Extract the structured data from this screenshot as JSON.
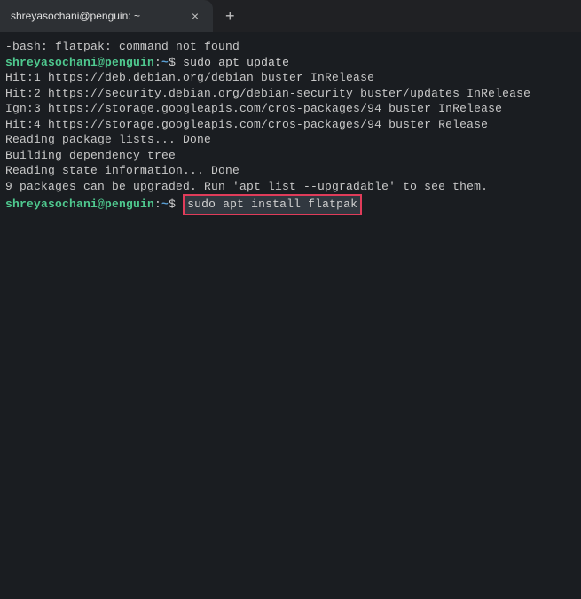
{
  "tab": {
    "title": "shreyasochani@penguin: ~",
    "close": "×",
    "new": "+"
  },
  "prompt": {
    "user_host": "shreyasochani@penguin",
    "colon": ":",
    "path": "~",
    "dollar": "$ "
  },
  "lines": {
    "err": "-bash: flatpak: command not found",
    "cmd1": "sudo apt update",
    "hit1": "Hit:1 https://deb.debian.org/debian buster InRelease",
    "hit2": "Hit:2 https://security.debian.org/debian-security buster/updates InRelease",
    "ign3": "Ign:3 https://storage.googleapis.com/cros-packages/94 buster InRelease",
    "hit4": "Hit:4 https://storage.googleapis.com/cros-packages/94 buster Release",
    "read1": "Reading package lists... Done",
    "build": "Building dependency tree",
    "read2": "Reading state information... Done",
    "upgrade": "9 packages can be upgraded. Run 'apt list --upgradable' to see them.",
    "cmd2": "sudo apt install flatpak"
  }
}
